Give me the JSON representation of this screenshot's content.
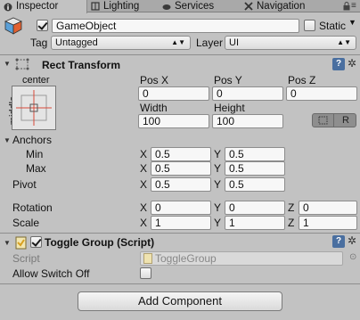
{
  "tabs": [
    {
      "label": "Inspector",
      "icon": "info-icon"
    },
    {
      "label": "Lighting",
      "icon": "lighting-icon"
    },
    {
      "label": "Services",
      "icon": "cloud-icon"
    },
    {
      "label": "Navigation",
      "icon": "navigation-icon"
    }
  ],
  "header": {
    "name": "GameObject",
    "static_label": "Static",
    "tag_label": "Tag",
    "tag_value": "Untagged",
    "layer_label": "Layer",
    "layer_value": "UI"
  },
  "rect_transform": {
    "title": "Rect Transform",
    "anchor_preset_top": "center",
    "anchor_preset_side": "middle",
    "pos_x_label": "Pos X",
    "pos_x": "0",
    "pos_y_label": "Pos Y",
    "pos_y": "0",
    "pos_z_label": "Pos Z",
    "pos_z": "0",
    "width_label": "Width",
    "width": "100",
    "height_label": "Height",
    "height": "100",
    "raw_button": "R",
    "anchors_label": "Anchors",
    "min_label": "Min",
    "min_x": "0.5",
    "min_y": "0.5",
    "max_label": "Max",
    "max_x": "0.5",
    "max_y": "0.5",
    "pivot_label": "Pivot",
    "pivot_x": "0.5",
    "pivot_y": "0.5",
    "rotation_label": "Rotation",
    "rot_x": "0",
    "rot_y": "0",
    "rot_z": "0",
    "scale_label": "Scale",
    "scale_x": "1",
    "scale_y": "1",
    "scale_z": "1",
    "x": "X",
    "y": "Y",
    "z": "Z"
  },
  "toggle_group": {
    "title": "Toggle Group (Script)",
    "script_label": "Script",
    "script_value": "ToggleGroup",
    "allow_switch_off_label": "Allow Switch Off"
  },
  "add_component": "Add Component",
  "colors": {
    "panel": "#c2c2c2",
    "tabbar": "#a9a9a9",
    "field": "#f7f7f7"
  }
}
